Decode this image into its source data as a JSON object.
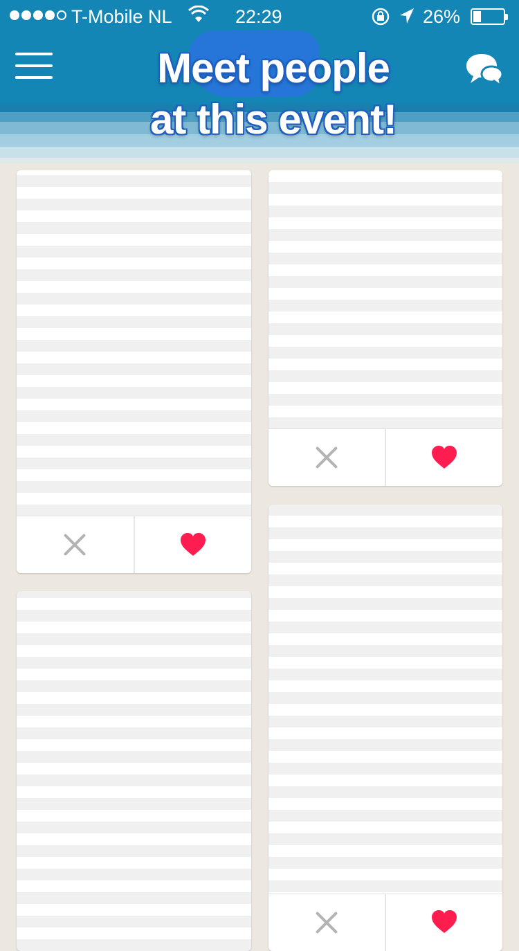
{
  "status_bar": {
    "carrier": "T-Mobile NL",
    "time": "22:29",
    "battery_percent": "26%",
    "battery_level": 0.26,
    "signal_dots_filled": 4,
    "signal_dots_total": 5
  },
  "header": {
    "headline_line1": "Meet people",
    "headline_line2": "at this event!",
    "menu_icon": "hamburger-menu-icon",
    "chat_icon": "chat-bubbles-icon"
  },
  "colors": {
    "header_blue": "#1486b6",
    "heart_red": "#ff1d4f",
    "x_gray": "#b3b3b3",
    "background": "#ece8df"
  },
  "cards": [
    {
      "skip_icon": "close-x-icon",
      "like_icon": "heart-icon"
    },
    {
      "skip_icon": "close-x-icon",
      "like_icon": "heart-icon"
    },
    {
      "skip_icon": "close-x-icon",
      "like_icon": "heart-icon"
    },
    {
      "skip_icon": "close-x-icon",
      "like_icon": "heart-icon"
    }
  ]
}
